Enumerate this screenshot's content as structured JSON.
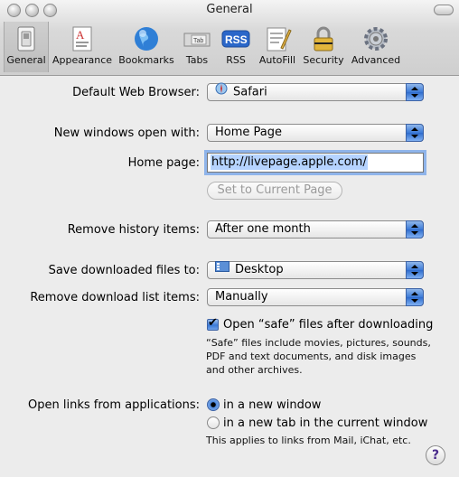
{
  "window": {
    "title": "General"
  },
  "toolbar": {
    "items": [
      {
        "label": "General",
        "icon": "general-switch-icon",
        "selected": true
      },
      {
        "label": "Appearance",
        "icon": "appearance-icon"
      },
      {
        "label": "Bookmarks",
        "icon": "bookmarks-globe-icon"
      },
      {
        "label": "Tabs",
        "icon": "tabs-icon"
      },
      {
        "label": "RSS",
        "icon": "rss-icon"
      },
      {
        "label": "AutoFill",
        "icon": "autofill-icon"
      },
      {
        "label": "Security",
        "icon": "security-lock-icon"
      },
      {
        "label": "Advanced",
        "icon": "advanced-gear-icon"
      }
    ]
  },
  "tab_icon_text": "Tab",
  "rss_icon_text": "RSS",
  "form": {
    "default_browser_label": "Default Web Browser:",
    "default_browser_value": "Safari",
    "new_windows_label": "New windows open with:",
    "new_windows_value": "Home Page",
    "home_page_label": "Home page:",
    "home_page_value": "http://livepage.apple.com/",
    "set_current_page_label": "Set to Current Page",
    "remove_history_label": "Remove history items:",
    "remove_history_value": "After one month",
    "save_downloads_label": "Save downloaded files to:",
    "save_downloads_value": "Desktop",
    "remove_download_list_label": "Remove download list items:",
    "remove_download_list_value": "Manually",
    "open_safe_label": "Open “safe” files after downloading",
    "open_safe_checked": true,
    "open_safe_note_1": "“Safe” files include movies, pictures, sounds,",
    "open_safe_note_2": "PDF and text documents, and disk images",
    "open_safe_note_3": "and other archives.",
    "open_links_label": "Open links from applications:",
    "open_links_option_1": "in a new window",
    "open_links_option_2": "in a new tab in the current window",
    "open_links_selected": "in a new window",
    "open_links_note": "This applies to links from Mail, iChat, etc.",
    "help_label": "?"
  }
}
